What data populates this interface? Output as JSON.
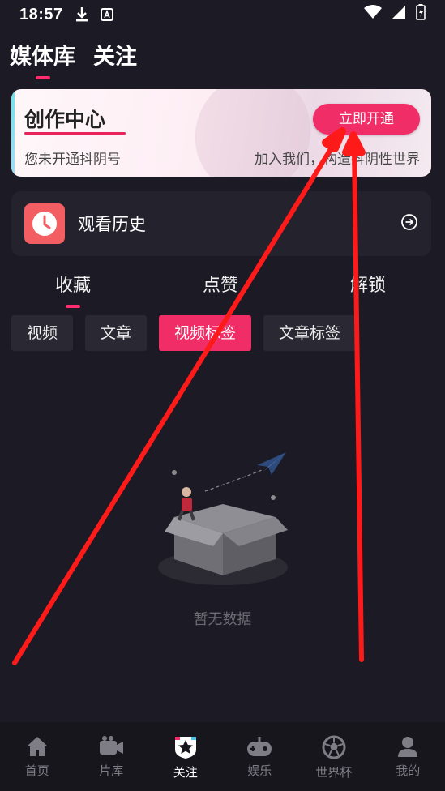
{
  "status": {
    "time": "18:57",
    "download_icon": "download-icon",
    "keyboard_icon": "keyboard-a-icon"
  },
  "top_tabs": [
    {
      "label": "媒体库",
      "active": true
    },
    {
      "label": "关注",
      "active": false
    }
  ],
  "creator": {
    "title": "创作中心",
    "subtitle": "您未开通抖阴号",
    "slogan": "加入我们，构造抖阴性世界",
    "button": "立即开通"
  },
  "history": {
    "label": "观看历史"
  },
  "sub_tabs": [
    {
      "label": "收藏",
      "active": true
    },
    {
      "label": "点赞"
    },
    {
      "label": "解锁"
    }
  ],
  "filters": [
    {
      "label": "视频"
    },
    {
      "label": "文章"
    },
    {
      "label": "视频标签",
      "active": true
    },
    {
      "label": "文章标签"
    }
  ],
  "empty_text": "暂无数据",
  "bottom_nav": [
    {
      "label": "首页",
      "icon": "home-icon"
    },
    {
      "label": "片库",
      "icon": "video-camera-icon"
    },
    {
      "label": "关注",
      "icon": "star-shield-icon",
      "active": true
    },
    {
      "label": "娱乐",
      "icon": "gamepad-icon"
    },
    {
      "label": "世界杯",
      "icon": "football-icon"
    },
    {
      "label": "我的",
      "icon": "profile-icon"
    }
  ],
  "colors": {
    "accent": "#f02d66",
    "background": "#1c1a24",
    "card": "#24222c",
    "annotation_arrow": "#ff1a1a"
  }
}
